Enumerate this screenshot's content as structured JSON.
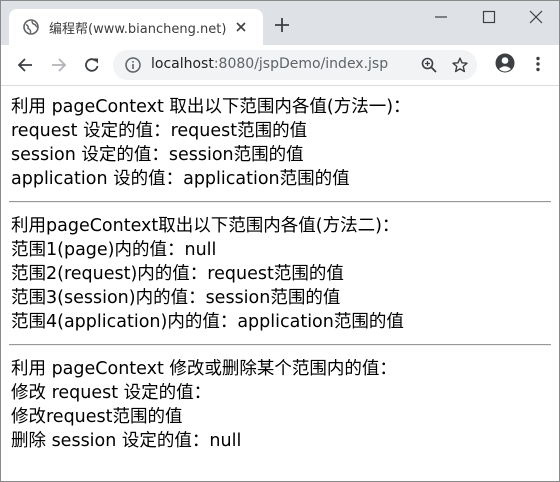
{
  "browser": {
    "tab": {
      "title": "编程帮(www.biancheng.net)"
    },
    "address": {
      "host": "localhost",
      "path": ":8080/jspDemo/index.jsp"
    }
  },
  "page": {
    "section1": {
      "heading": "利用 pageContext 取出以下范围内各值(方法一)：",
      "lines": [
        "request 设定的值：request范围的值",
        "session 设定的值：session范围的值",
        "application 设的值：application范围的值"
      ]
    },
    "section2": {
      "heading": "利用pageContext取出以下范围内各值(方法二)：",
      "lines": [
        "范围1(page)内的值：null",
        "范围2(request)内的值：request范围的值",
        "范围3(session)内的值：session范围的值",
        "范围4(application)内的值：application范围的值"
      ]
    },
    "section3": {
      "heading": "利用 pageContext 修改或删除某个范围内的值：",
      "lines": [
        "修改 request 设定的值：",
        "修改request范围的值",
        "删除 session 设定的值：null"
      ]
    }
  }
}
